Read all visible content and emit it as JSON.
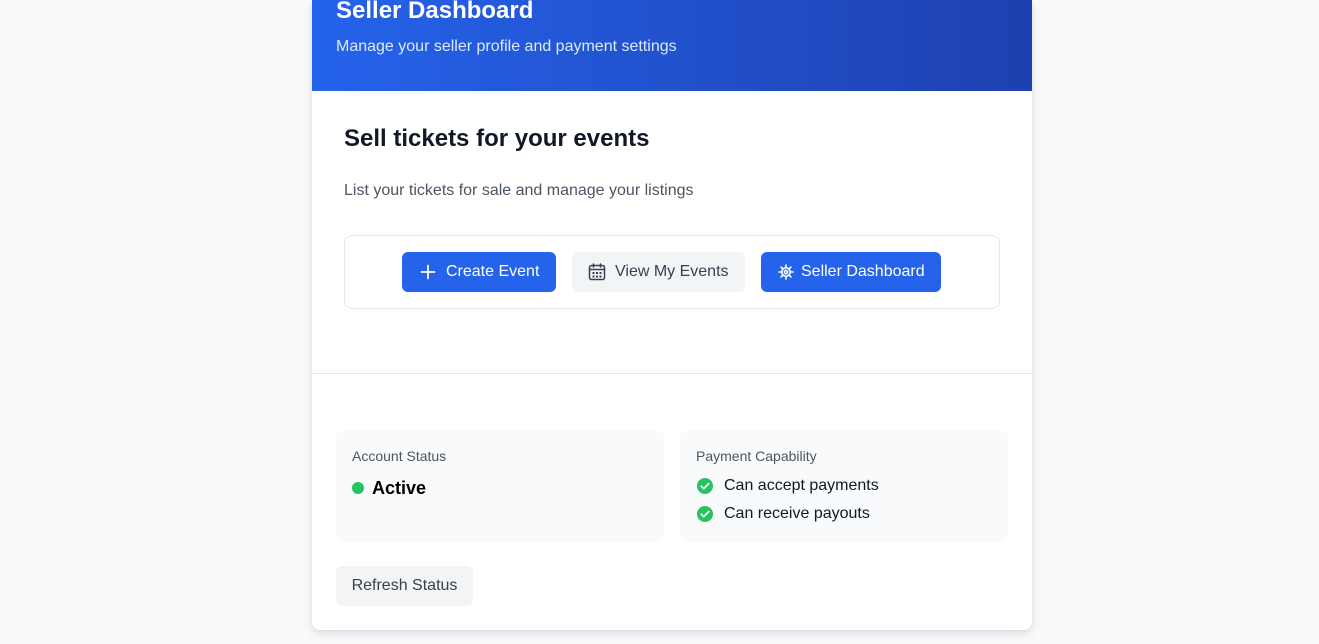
{
  "header": {
    "title": "Seller Dashboard",
    "subtitle": "Manage your seller profile and payment settings"
  },
  "sell_section": {
    "title": "Sell tickets for your events",
    "description": "List your tickets for sale and manage your listings",
    "buttons": {
      "create_event": {
        "label": "Create Event",
        "icon": "plus-icon"
      },
      "view_events": {
        "label": "View My Events",
        "icon": "calendar-icon"
      },
      "seller_dashboard": {
        "label": "Seller Dashboard",
        "icon": "gear-icon"
      }
    }
  },
  "account_status": {
    "label": "Account Status",
    "value": "Active",
    "indicator_color": "#22c55e"
  },
  "payment_capability": {
    "label": "Payment Capability",
    "items": [
      "Can accept payments",
      "Can receive payouts"
    ],
    "check_color": "#22c55e"
  },
  "refresh_button": {
    "label": "Refresh Status"
  },
  "colors": {
    "primary": "#2563eb",
    "header_gradient_end": "#1e40af",
    "success": "#22c55e",
    "page_background": "#f8fafc"
  }
}
